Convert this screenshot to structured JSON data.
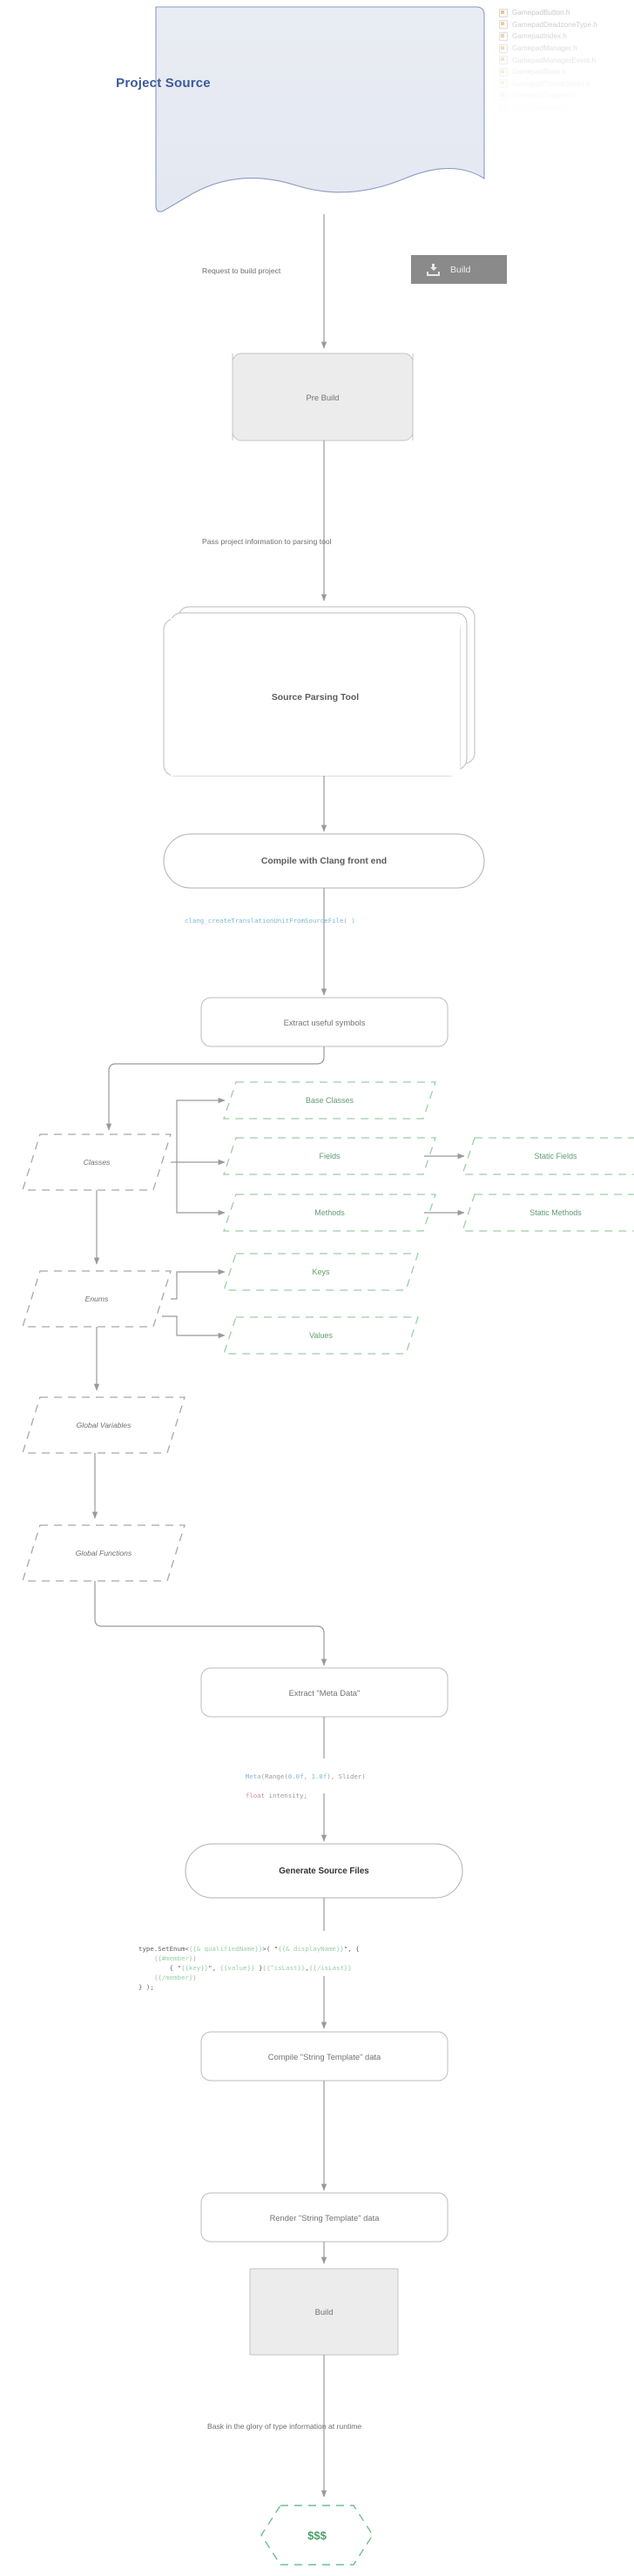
{
  "diagram": {
    "title": "Project Source",
    "nodes": {
      "project_source": "Project Source",
      "pre_build": "Pre Build",
      "source_parsing_tool": "Source Parsing Tool",
      "compile_clang": "Compile with Clang front end",
      "extract_symbols": "Extract useful symbols",
      "classes": "Classes",
      "enums": "Enums",
      "global_variables": "Global Variables",
      "global_functions": "Global Functions",
      "base_classes": "Base Classes",
      "fields": "Fields",
      "methods": "Methods",
      "static_fields": "Static Fields",
      "static_methods": "Static Methods",
      "keys": "Keys",
      "values": "Values",
      "extract_meta_data": "Extract \"Meta Data\"",
      "generate_source_files": "Generate Source Files",
      "compile_string_template": "Compile \"String Template\" data",
      "render_string_template": "Render \"String Template\" data",
      "build": "Build",
      "money": "$$$"
    },
    "edge_labels": {
      "request_build": "Request to build project",
      "pass_project_info": "Pass project information to parsing tool",
      "bask_glory": "Bask in the glory of type information at runtime"
    },
    "build_button": {
      "label": "Build",
      "icon": "download-build-icon"
    },
    "code_snippets": {
      "clang_call": "clang_createTranslationUnitFromSourceFile( )",
      "meta_line1_a": "Meta",
      "meta_line1_b": "(Range(",
      "meta_line1_c": "0.0f",
      "meta_line1_d": ", ",
      "meta_line1_e": "1.0f",
      "meta_line1_f": "), Slider)",
      "meta_line2_a": "float",
      "meta_line2_b": " intensity;",
      "template_l1_a": "type.SetEnum<",
      "template_l1_b": "{{& qualifiedName}}",
      "template_l1_c": ">( \"",
      "template_l1_d": "{{& displayName}}",
      "template_l1_e": "\", {",
      "template_l2": "{{#member}}",
      "template_l3_a": "{ \"",
      "template_l3_b": "{{key}}",
      "template_l3_c": "\", ",
      "template_l3_d": "{{value}}",
      "template_l3_e": " }",
      "template_l3_f": "{{^isLast}}",
      "template_l3_g": ",",
      "template_l3_h": "{{/isLast}}",
      "template_l4": "{{/member}}",
      "template_l5": "} );"
    },
    "file_list": [
      {
        "name": "GamepadButton.h",
        "opacity": 1.0
      },
      {
        "name": "GamepadDeadzoneType.h",
        "opacity": 0.88
      },
      {
        "name": "GamepadIndex.h",
        "opacity": 0.76
      },
      {
        "name": "GamepadManager.h",
        "opacity": 0.62
      },
      {
        "name": "GamepadManagerEvent.h",
        "opacity": 0.46
      },
      {
        "name": "GamepadState.h",
        "opacity": 0.32
      },
      {
        "name": "GamepadThumbSticks.h",
        "opacity": 0.2
      },
      {
        "name": "GamepadTriggers.h",
        "opacity": 0.11
      },
      {
        "name": "VirtualGamepad.h",
        "opacity": 0.05
      }
    ],
    "colors": {
      "title_blue": "#3c5a99",
      "doc_fill": "#e7eaf2",
      "doc_stroke": "#8c9ac4",
      "edge_gray": "#9a9a9a",
      "green_dashed": "#9ccfa3",
      "green_text": "#5f9c72",
      "money_green": "#4da06a",
      "button_gray": "#8a8a8a",
      "code_blue": "#7fb8d8",
      "code_pink": "#d08aa6"
    }
  }
}
